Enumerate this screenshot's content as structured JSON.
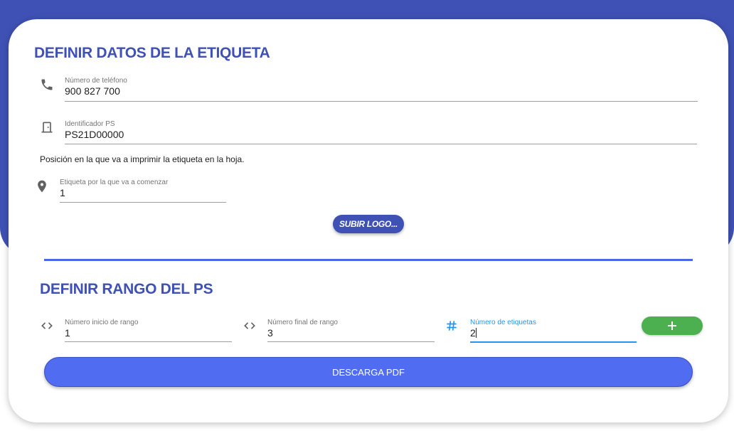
{
  "colors": {
    "primary": "#3f51b5",
    "accent": "#2196f3",
    "add_button": "#4caf50",
    "download_button": "#506cf0"
  },
  "label_section": {
    "title": "DEFINIR DATOS DE LA ETIQUETA",
    "phone": {
      "label": "Número de teléfono",
      "value": "900 827 700",
      "icon": "phone-icon"
    },
    "ps_id": {
      "label": "Identificador PS",
      "value": "PS21D00000",
      "icon": "door-icon"
    },
    "position_note": "Posición en la que va a imprimir la etiqueta en la hoja.",
    "start_label": {
      "label": "Etiqueta por la que va a comenzar",
      "value": "1",
      "icon": "location-pin-icon"
    },
    "upload_logo_label": "SUBIR LOGO..."
  },
  "range_section": {
    "title": "DEFINIR RANGO DEL PS",
    "range_start": {
      "label": "Número inicio de rango",
      "value": "1",
      "icon": "code-icon"
    },
    "range_end": {
      "label": "Número final de rango",
      "value": "3",
      "icon": "code-icon"
    },
    "label_count": {
      "label": "Número de etiquetas",
      "value": "2",
      "icon": "hash-icon"
    },
    "add_label": "+",
    "download_label": "DESCARGA PDF"
  }
}
